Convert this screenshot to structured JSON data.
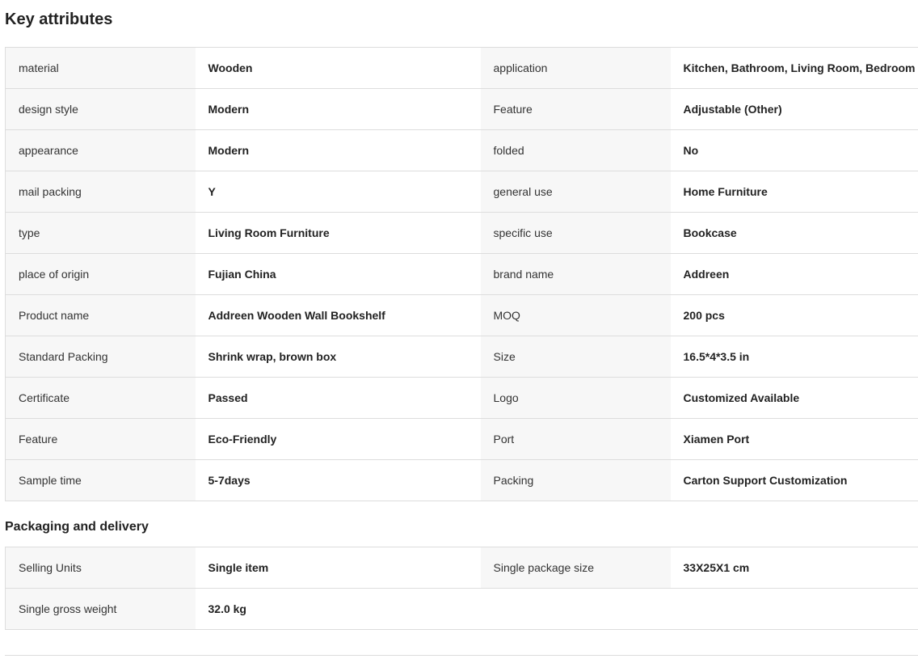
{
  "key_attributes": {
    "title": "Key attributes",
    "rows": [
      {
        "l1": "material",
        "v1": "Wooden",
        "l2": "application",
        "v2": "Kitchen, Bathroom, Living Room, Bedroom"
      },
      {
        "l1": "design style",
        "v1": "Modern",
        "l2": "Feature",
        "v2": "Adjustable (Other)"
      },
      {
        "l1": "appearance",
        "v1": "Modern",
        "l2": "folded",
        "v2": "No"
      },
      {
        "l1": "mail packing",
        "v1": "Y",
        "l2": "general use",
        "v2": "Home Furniture"
      },
      {
        "l1": "type",
        "v1": "Living Room Furniture",
        "l2": "specific use",
        "v2": "Bookcase"
      },
      {
        "l1": "place of origin",
        "v1": "Fujian China",
        "l2": "brand name",
        "v2": "Addreen"
      },
      {
        "l1": "Product name",
        "v1": "Addreen Wooden Wall Bookshelf",
        "l2": "MOQ",
        "v2": "200 pcs"
      },
      {
        "l1": "Standard Packing",
        "v1": "Shrink wrap, brown box",
        "l2": "Size",
        "v2": "16.5*4*3.5 in"
      },
      {
        "l1": "Certificate",
        "v1": "Passed",
        "l2": "Logo",
        "v2": "Customized Available"
      },
      {
        "l1": "Feature",
        "v1": "Eco-Friendly",
        "l2": "Port",
        "v2": "Xiamen Port"
      },
      {
        "l1": "Sample time",
        "v1": "5-7days",
        "l2": "Packing",
        "v2": "Carton Support Customization"
      }
    ]
  },
  "packaging_delivery": {
    "title": "Packaging and delivery",
    "rows": [
      {
        "l1": "Selling Units",
        "v1": "Single item",
        "l2": "Single package size",
        "v2": "33X25X1 cm"
      },
      {
        "l1": "Single gross weight",
        "v1": "32.0 kg",
        "l2": "",
        "v2": ""
      }
    ]
  }
}
